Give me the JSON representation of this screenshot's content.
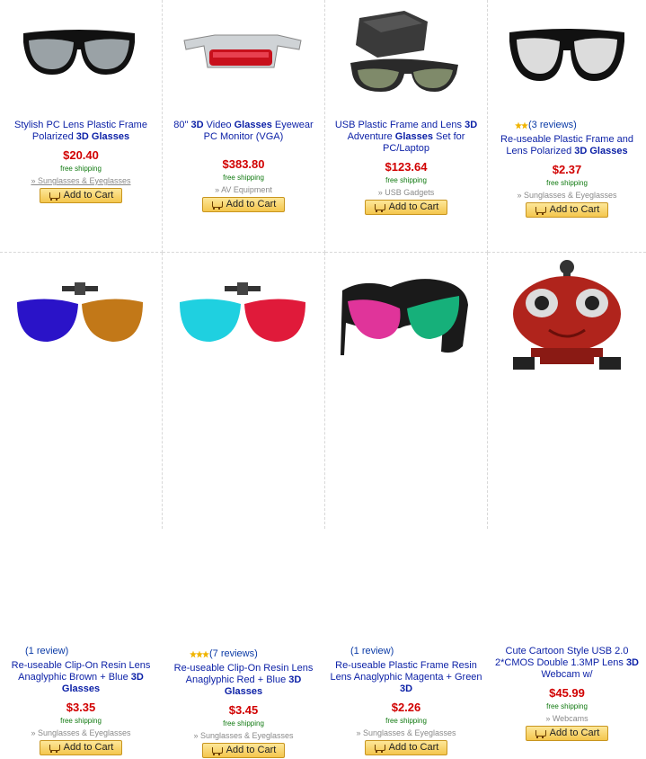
{
  "products": [
    {
      "title_pre": "Stylish PC Lens Plastic Frame Polarized ",
      "title_bold": "3D Glasses",
      "title_post": "",
      "price": "$20.40",
      "shipping": "free shipping",
      "category": "» Sunglasses & Eyeglasses",
      "cart": "Add to Cart",
      "reviews": ""
    },
    {
      "title_pre": "80\" ",
      "title_bold": "3D",
      "title_mid": " Video ",
      "title_bold2": "Glasses",
      "title_post": " Eyewear PC Monitor (VGA)",
      "price": "$383.80",
      "shipping": "free shipping",
      "category": "» AV Equipment",
      "cart": "Add to Cart",
      "reviews": ""
    },
    {
      "title_pre": "USB Plastic Frame and Lens ",
      "title_bold": "3D",
      "title_mid": " Adventure ",
      "title_bold2": "Glasses",
      "title_post": " Set for PC/Laptop",
      "price": "$123.64",
      "shipping": "free shipping",
      "category": "» USB Gadgets",
      "cart": "Add to Cart",
      "reviews": ""
    },
    {
      "title_pre": "Re-useable Plastic Frame and Lens Polarized ",
      "title_bold": "3D Glasses",
      "title_post": "",
      "price": "$2.37",
      "shipping": "free shipping",
      "category": "» Sunglasses & Eyeglasses",
      "cart": "Add to Cart",
      "reviews": "(3 reviews)"
    },
    {
      "title_pre": "Re-useable Clip-On Resin Lens Anaglyphic Brown + Blue ",
      "title_bold": "3D Glasses",
      "title_post": "",
      "price": "$3.35",
      "shipping": "free shipping",
      "category": "» Sunglasses & Eyeglasses",
      "cart": "Add to Cart",
      "reviews": "(1 review)"
    },
    {
      "title_pre": "Re-useable Clip-On Resin Lens Anaglyphic Red + Blue ",
      "title_bold": "3D Glasses",
      "title_post": "",
      "price": "$3.45",
      "shipping": "free shipping",
      "category": "» Sunglasses & Eyeglasses",
      "cart": "Add to Cart",
      "reviews": "(7 reviews)"
    },
    {
      "title_pre": "Re-useable Plastic Frame Resin Lens Anaglyphic Magenta + Green ",
      "title_bold": "3D",
      "title_post": "",
      "price": "$2.26",
      "shipping": "free shipping",
      "category": "» Sunglasses & Eyeglasses",
      "cart": "Add to Cart",
      "reviews": "(1 review)"
    },
    {
      "title_pre": "Cute Cartoon Style USB 2.0 2*CMOS Double 1.3MP Lens ",
      "title_bold": "3D",
      "title_post": " Webcam w/",
      "price": "$45.99",
      "shipping": "free shipping",
      "category": "» Webcams",
      "cart": "Add to Cart",
      "reviews": ""
    }
  ],
  "icons": {
    "cart": "cart-icon",
    "star": "star-icon"
  },
  "colors": {
    "link": "#0a1fa6",
    "price": "#d10000",
    "shipping": "#117a11",
    "button": "#f4c64d"
  }
}
